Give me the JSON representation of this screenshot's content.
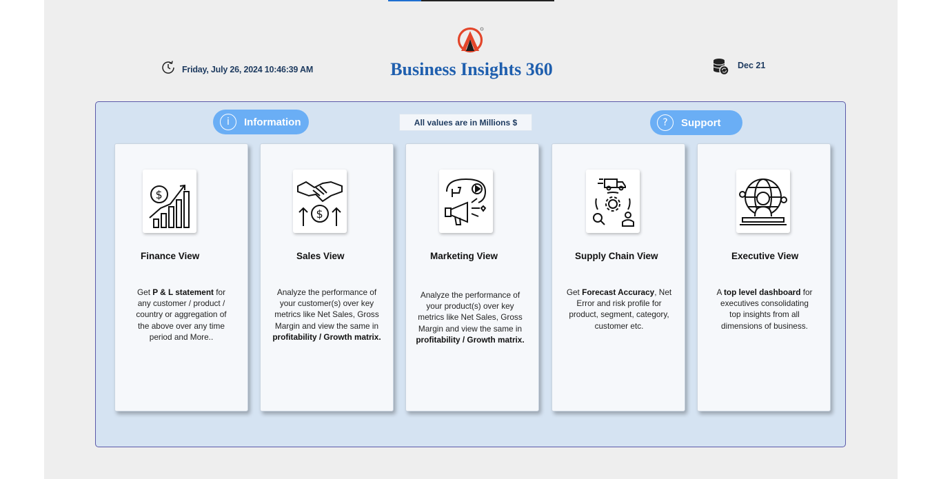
{
  "header": {
    "title": "Business Insights 360",
    "datetime": "Friday, July 26, 2024 10:46:39 AM",
    "refresh_date": "Dec 21"
  },
  "toolbar": {
    "information_label": "Information",
    "support_label": "Support",
    "units_note": "All values are in Millions $"
  },
  "cards": [
    {
      "title": "Finance View",
      "icon": "finance-growth-icon",
      "desc": [
        "Get ",
        "P & L statement",
        " for any customer / product / country or aggregation of the above over any time period and More.."
      ]
    },
    {
      "title": "Sales View",
      "icon": "handshake-money-icon",
      "desc": [
        "Analyze the performance of your customer(s) over key metrics like Net Sales, Gross Margin and view the same in ",
        "profitability / Growth matrix.",
        ""
      ]
    },
    {
      "title": "Marketing View",
      "icon": "marketing-megaphone-icon",
      "desc": [
        "Analyze the performance of your product(s) over key metrics like Net Sales, Gross Margin and view the same in ",
        "profitability / Growth matrix.",
        ""
      ]
    },
    {
      "title": "Supply Chain View",
      "icon": "supply-chain-icon",
      "desc": [
        "Get ",
        "Forecast Accuracy",
        ", Net Error and risk profile for product, segment, category, customer etc."
      ]
    },
    {
      "title": "Executive View",
      "icon": "executive-globe-icon",
      "desc": [
        "A ",
        "top level dashboard",
        " for executives consolidating top insights from all dimensions of business."
      ]
    }
  ],
  "colors": {
    "accent": "#6aaef5",
    "title": "#1f5fae",
    "panel": "#d5e3f2",
    "logo_red": "#e3462b"
  }
}
